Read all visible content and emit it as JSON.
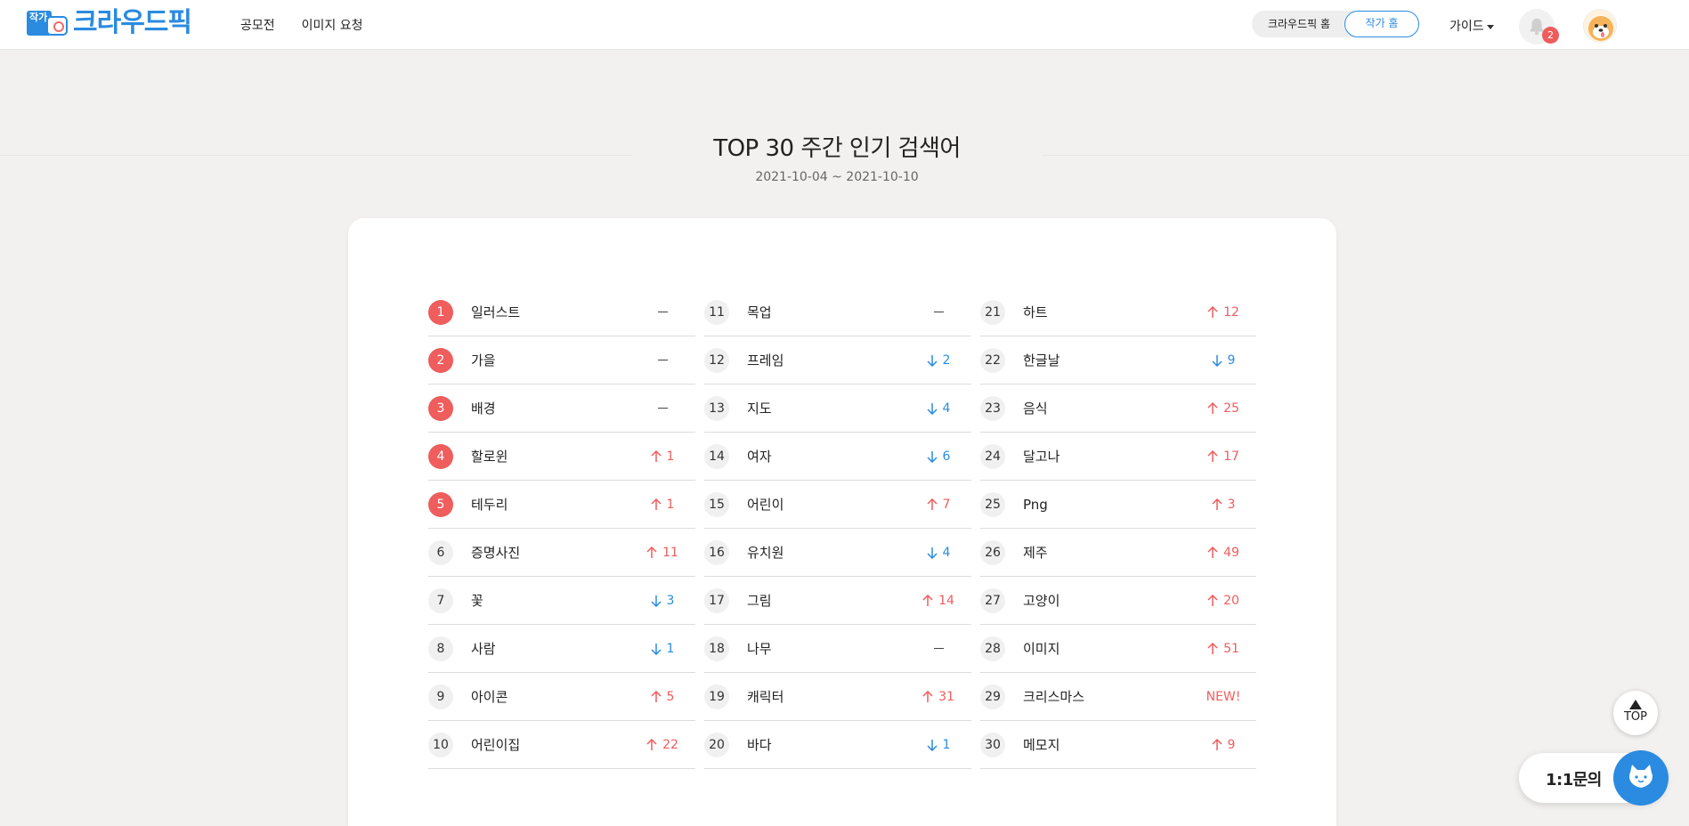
{
  "header": {
    "logo_badge": "작가",
    "logo_text": "크라우드픽",
    "nav": [
      "공모전",
      "이미지 요청"
    ],
    "site_home": "크라우드픽 홈",
    "artist_home": "작가 홈",
    "guide": "가이드",
    "notification_count": "2"
  },
  "main": {
    "title": "TOP 30 주간 인기 검색어",
    "period": "2021-10-04 ~ 2021-10-10"
  },
  "rankings": [
    {
      "rank": "1",
      "keyword": "일러스트",
      "trend": "same",
      "change": ""
    },
    {
      "rank": "2",
      "keyword": "가을",
      "trend": "same",
      "change": ""
    },
    {
      "rank": "3",
      "keyword": "배경",
      "trend": "same",
      "change": ""
    },
    {
      "rank": "4",
      "keyword": "할로윈",
      "trend": "up",
      "change": "1"
    },
    {
      "rank": "5",
      "keyword": "테두리",
      "trend": "up",
      "change": "1"
    },
    {
      "rank": "6",
      "keyword": "증명사진",
      "trend": "up",
      "change": "11"
    },
    {
      "rank": "7",
      "keyword": "꽃",
      "trend": "down",
      "change": "3"
    },
    {
      "rank": "8",
      "keyword": "사람",
      "trend": "down",
      "change": "1"
    },
    {
      "rank": "9",
      "keyword": "아이콘",
      "trend": "up",
      "change": "5"
    },
    {
      "rank": "10",
      "keyword": "어린이집",
      "trend": "up",
      "change": "22"
    },
    {
      "rank": "11",
      "keyword": "목업",
      "trend": "same",
      "change": ""
    },
    {
      "rank": "12",
      "keyword": "프레임",
      "trend": "down",
      "change": "2"
    },
    {
      "rank": "13",
      "keyword": "지도",
      "trend": "down",
      "change": "4"
    },
    {
      "rank": "14",
      "keyword": "여자",
      "trend": "down",
      "change": "6"
    },
    {
      "rank": "15",
      "keyword": "어린이",
      "trend": "up",
      "change": "7"
    },
    {
      "rank": "16",
      "keyword": "유치원",
      "trend": "down",
      "change": "4"
    },
    {
      "rank": "17",
      "keyword": "그림",
      "trend": "up",
      "change": "14"
    },
    {
      "rank": "18",
      "keyword": "나무",
      "trend": "same",
      "change": ""
    },
    {
      "rank": "19",
      "keyword": "캐릭터",
      "trend": "up",
      "change": "31"
    },
    {
      "rank": "20",
      "keyword": "바다",
      "trend": "down",
      "change": "1"
    },
    {
      "rank": "21",
      "keyword": "하트",
      "trend": "up",
      "change": "12"
    },
    {
      "rank": "22",
      "keyword": "한글날",
      "trend": "down",
      "change": "9"
    },
    {
      "rank": "23",
      "keyword": "음식",
      "trend": "up",
      "change": "25"
    },
    {
      "rank": "24",
      "keyword": "달고나",
      "trend": "up",
      "change": "17"
    },
    {
      "rank": "25",
      "keyword": "Png",
      "trend": "up",
      "change": "3"
    },
    {
      "rank": "26",
      "keyword": "제주",
      "trend": "up",
      "change": "49"
    },
    {
      "rank": "27",
      "keyword": "고양이",
      "trend": "up",
      "change": "20"
    },
    {
      "rank": "28",
      "keyword": "이미지",
      "trend": "up",
      "change": "51"
    },
    {
      "rank": "29",
      "keyword": "크리스마스",
      "trend": "new",
      "change": "NEW!"
    },
    {
      "rank": "30",
      "keyword": "메모지",
      "trend": "up",
      "change": "9"
    }
  ],
  "floating": {
    "top_label": "TOP",
    "chat_label": "1:1문의"
  },
  "colors": {
    "brand": "#2a8be0",
    "up": "#ef5d5d",
    "down": "#2a8be0"
  }
}
